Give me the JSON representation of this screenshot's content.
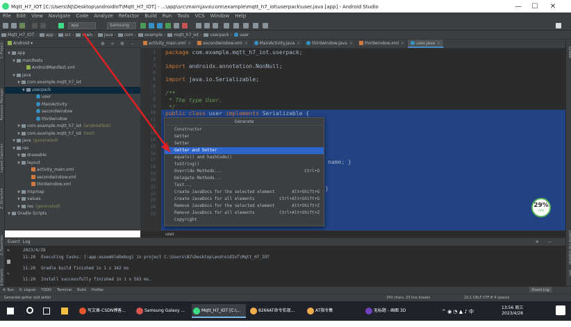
{
  "window": {
    "title": "Mqtt_H7_IOT [C:\\Users\\NJ\\Desktop\\androidIoT\\Mqtt_H7_IOT] - ...\\app\\src\\main\\java\\com\\example\\mqtt_h7_iot\\userpack\\user.java [app] - Android Studio",
    "minimize": "—",
    "maximize": "☐",
    "close": "✕"
  },
  "menu": [
    "File",
    "Edit",
    "View",
    "Navigate",
    "Code",
    "Analyze",
    "Refactor",
    "Build",
    "Run",
    "Tools",
    "VCS",
    "Window",
    "Help"
  ],
  "toolbar": {
    "module_combo": "app",
    "device_combo": "Samsung"
  },
  "breadcrumbs": [
    "Mqtt_H7_IOT",
    "app",
    "src",
    "main",
    "java",
    "com",
    "example",
    "mqtt_h7_iot",
    "userpack",
    "user"
  ],
  "project": {
    "view": "Android",
    "tree": [
      {
        "label": "app",
        "indent": 0,
        "icon": "folder"
      },
      {
        "label": "manifests",
        "indent": 1,
        "icon": "folder"
      },
      {
        "label": "AndroidManifest.xml",
        "indent": 3,
        "icon": "man"
      },
      {
        "label": "java",
        "indent": 1,
        "icon": "folder"
      },
      {
        "label": "com.example.mqtt_h7_iot",
        "indent": 2,
        "icon": "pkg"
      },
      {
        "label": "userpack",
        "indent": 3,
        "icon": "pkg",
        "selected": true
      },
      {
        "label": "user",
        "indent": 5,
        "icon": "cls"
      },
      {
        "label": "MainActivity",
        "indent": 5,
        "icon": "cls"
      },
      {
        "label": "secondwindow",
        "indent": 5,
        "icon": "cls"
      },
      {
        "label": "thirdwindow",
        "indent": 5,
        "icon": "cls"
      },
      {
        "label": "com.example.mqtt_h7_iot",
        "suffix": "(androidTest)",
        "indent": 2,
        "icon": "pkg"
      },
      {
        "label": "com.example.mqtt_h7_iot",
        "suffix": "(test)",
        "indent": 2,
        "icon": "pkg"
      },
      {
        "label": "java",
        "suffix": "(generated)",
        "indent": 1,
        "icon": "folder"
      },
      {
        "label": "res",
        "indent": 1,
        "icon": "folder"
      },
      {
        "label": "drawable",
        "indent": 2,
        "icon": "folder"
      },
      {
        "label": "layout",
        "indent": 2,
        "icon": "folder"
      },
      {
        "label": "activity_main.xml",
        "indent": 4,
        "icon": "xml"
      },
      {
        "label": "secondwindow.xml",
        "indent": 4,
        "icon": "xml"
      },
      {
        "label": "thirdwindow.xml",
        "indent": 4,
        "icon": "xml"
      },
      {
        "label": "mipmap",
        "indent": 2,
        "icon": "folder"
      },
      {
        "label": "values",
        "indent": 2,
        "icon": "folder"
      },
      {
        "label": "res",
        "suffix": "(generated)",
        "indent": 2,
        "icon": "folder"
      },
      {
        "label": "Gradle Scripts",
        "indent": 0,
        "icon": "folder"
      }
    ]
  },
  "tabs": [
    {
      "label": "activity_main.xml",
      "icon": "xml"
    },
    {
      "label": "secondwindow.xml",
      "icon": "xml"
    },
    {
      "label": "MainActivity.java",
      "icon": "cls"
    },
    {
      "label": "thirdwindow.java",
      "icon": "cls"
    },
    {
      "label": "thirdwindow.xml",
      "icon": "xml"
    },
    {
      "label": "user.java",
      "icon": "cls",
      "active": true
    }
  ],
  "editor": {
    "line_numbers": [
      "1",
      "2",
      "3",
      "4",
      "5",
      "6",
      "7",
      "8",
      "9",
      "10",
      "11",
      "12",
      "13",
      "14",
      "15",
      "16",
      "17",
      "18",
      "19",
      "20",
      "21",
      "22",
      "23",
      "24",
      "25"
    ],
    "package_kw": "package",
    "package_name": " com.example.mqtt_h7_iot.userpack;",
    "import1_kw": "import",
    "import1": " androidx.annotation.NonNull;",
    "import2_kw": "import",
    "import2": " java.io.Serializable;",
    "doc_open": "/**",
    "doc_line": " * The type User.",
    "doc_close": " */",
    "class_kw1": "public class",
    "class_name": " user ",
    "class_kw2": "implements",
    "class_rest": " Serializable {",
    "partial_code": "name; }",
    "partial_brace": "}",
    "crumb": "user"
  },
  "generate_popup": {
    "title": "Generate",
    "items": [
      {
        "label": "Constructor",
        "shortcut": ""
      },
      {
        "label": "Getter",
        "shortcut": ""
      },
      {
        "label": "Setter",
        "shortcut": ""
      },
      {
        "label": "Getter and Setter",
        "shortcut": "",
        "selected": true
      },
      {
        "label": "equals() and hashCode()",
        "shortcut": ""
      },
      {
        "label": "toString()",
        "shortcut": ""
      },
      {
        "label": "Override Methods...",
        "shortcut": "Ctrl+O"
      },
      {
        "label": "Delegate Methods...",
        "shortcut": ""
      },
      {
        "label": "Test...",
        "shortcut": ""
      },
      {
        "label": "Create JavaDocs for the selected element",
        "shortcut": "Alt+Shift+G"
      },
      {
        "label": "Create JavaDocs for all elements",
        "shortcut": "Ctrl+Alt+Shift+G"
      },
      {
        "label": "Remove JavaDocs for the selected element",
        "shortcut": "Alt+Shift+Z"
      },
      {
        "label": "Remove JavaDocs for all elements",
        "shortcut": "Ctrl+Alt+Shift+Z"
      },
      {
        "label": "Copyright",
        "shortcut": ""
      }
    ]
  },
  "memory": {
    "percent": "29%",
    "label": "Y/PC"
  },
  "event_log": {
    "title": "Event Log",
    "date": "2023/4/28",
    "lines": [
      {
        "time": "11:20",
        "text": "Executing tasks: [:app:assembleDebug] in project C:\\Users\\NJ\\Desktop\\androidIoT\\Mqtt_H7_IOT"
      },
      {
        "time": "11:20",
        "text": "Gradle build finished in 1 s 342 ms"
      },
      {
        "time": "11:20",
        "text": "Install successfully finished in 1 s 563 ms."
      }
    ]
  },
  "bottom_tabs": [
    "4: Run",
    "6: Logcat",
    "TODO",
    "Terminal",
    "Build",
    "Profiler"
  ],
  "bottom_right_tab": "Event Log",
  "status": {
    "message": "Generate getter and setter",
    "chars": "343 chars, 23 line breaks",
    "position": "10:1  CRLF  UTF-8  4 spaces"
  },
  "taskbar": {
    "apps": [
      {
        "label": "写文章-CSDN博客...",
        "color": "#e4572e"
      },
      {
        "label": "Samsung Galaxy ...",
        "color": "#d9534f"
      },
      {
        "label": "Mqtt_H7_IOT [C:\\...",
        "color": "#3ddc84",
        "active": true
      },
      {
        "label": "8266AT命令实现...",
        "color": "#f0ad4e"
      },
      {
        "label": "AT指令集",
        "color": "#f0ad4e"
      },
      {
        "label": "无标题 - 画图 3D",
        "color": "#6f42c1"
      }
    ],
    "time": "13:56 周三",
    "date": "2023/4/28"
  },
  "colors": {
    "arrow": "#e02020",
    "selection": "#2f65ca",
    "editor_bg": "#2b2b2b",
    "panel_bg": "#3c3f41"
  }
}
